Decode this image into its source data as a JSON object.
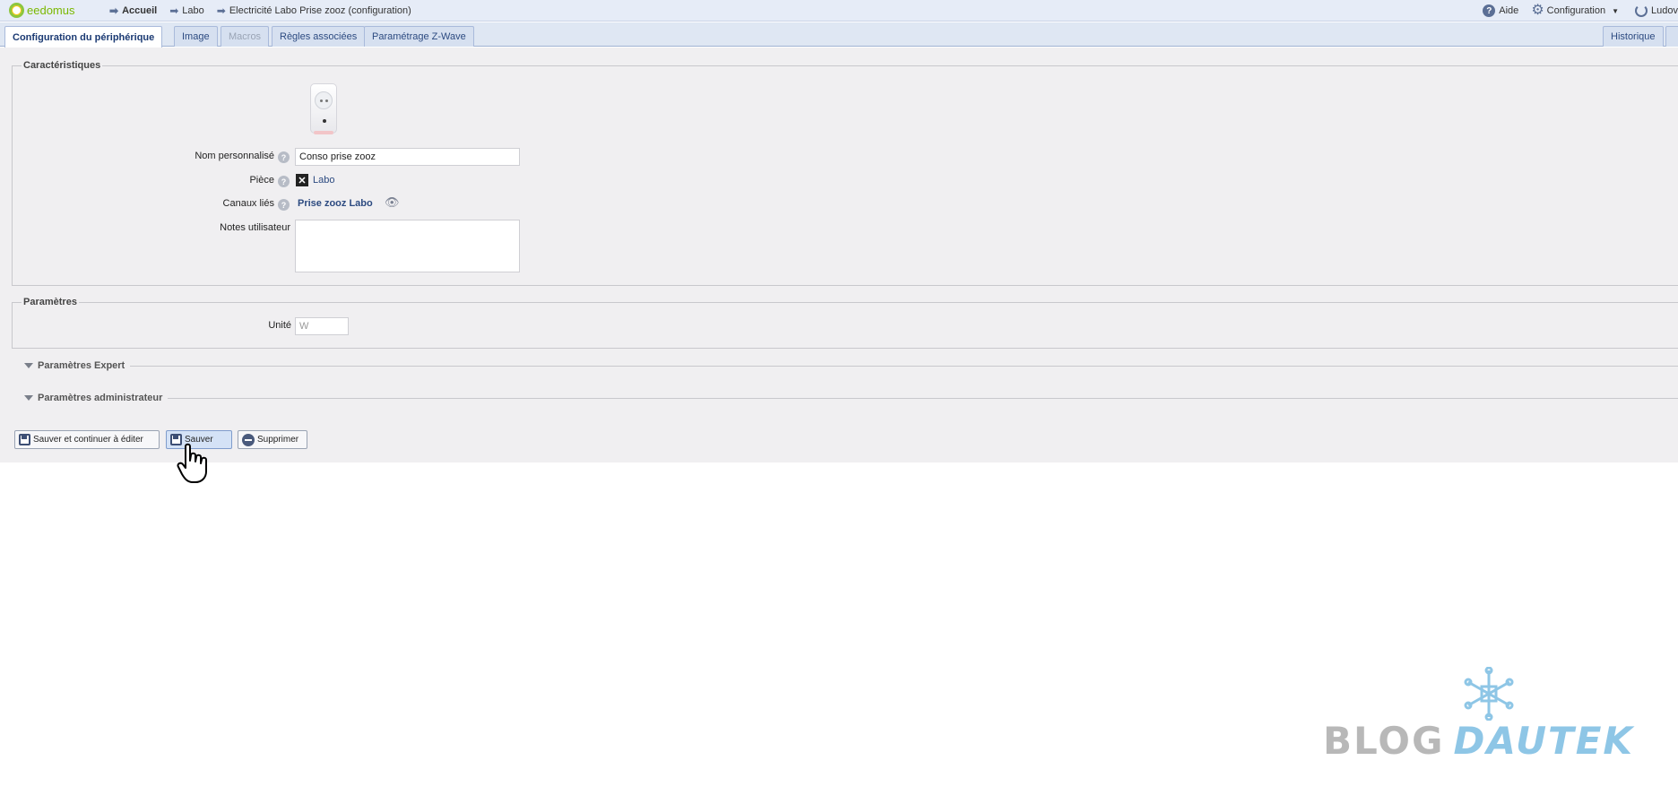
{
  "header": {
    "logo_text": "eedomus",
    "breadcrumbs": [
      "Accueil",
      "Labo",
      "Electricité Labo Prise zooz (configuration)"
    ],
    "help_label": "Aide",
    "config_label": "Configuration",
    "user_label": "Ludov"
  },
  "tabs": [
    {
      "label": "Configuration du périphérique",
      "state": "active"
    },
    {
      "label": "Image",
      "state": "normal"
    },
    {
      "label": "Macros",
      "state": "disabled"
    },
    {
      "label": "Règles associées",
      "state": "normal"
    },
    {
      "label": "Paramétrage Z-Wave",
      "state": "normal"
    }
  ],
  "right_tab": "Historique",
  "characteristics": {
    "legend": "Caractéristiques",
    "name_label": "Nom personnalisé",
    "name_value": "Conso prise zooz",
    "room_label": "Pièce",
    "room_value": "Labo",
    "channels_label": "Canaux liés",
    "channels_value": "Prise zooz Labo",
    "notes_label": "Notes utilisateur",
    "notes_value": ""
  },
  "parameters": {
    "legend": "Paramètres",
    "unit_label": "Unité",
    "unit_placeholder": "W"
  },
  "sections": {
    "expert": "Paramètres Expert",
    "admin": "Paramètres administrateur"
  },
  "buttons": {
    "save_continue": "Sauver et continuer à éditer",
    "save": "Sauver",
    "delete": "Supprimer"
  },
  "watermark": {
    "blog": "BLOG",
    "dautek": "DAUTEK"
  },
  "colors": {
    "header_bg": "#e6ecf7",
    "content_bg": "#f0eff1",
    "link": "#2c4a80",
    "brand_green": "#7ab800"
  }
}
